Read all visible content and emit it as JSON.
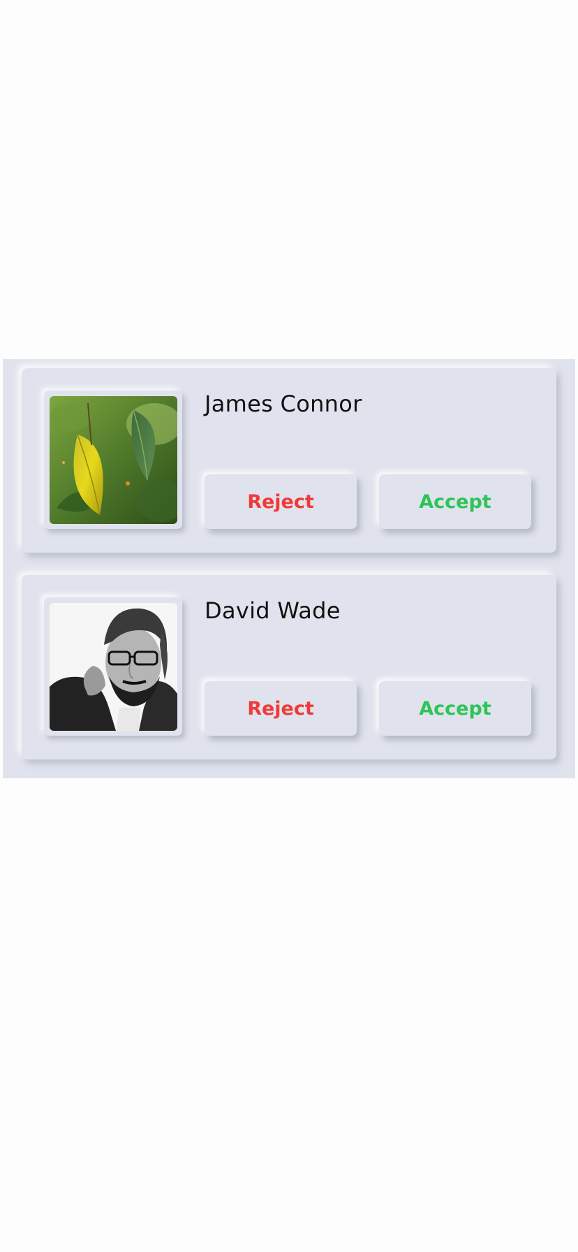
{
  "requests": [
    {
      "name": "James Connor",
      "avatar": "leaf-photo",
      "reject_label": "Reject",
      "accept_label": "Accept"
    },
    {
      "name": "David Wade",
      "avatar": "person-photo",
      "reject_label": "Reject",
      "accept_label": "Accept"
    }
  ],
  "colors": {
    "panel_bg": "#e0e3ed",
    "page_bg": "#fdfdfd",
    "reject": "#f03a3a",
    "accept": "#2ec458",
    "name_text": "#111111"
  }
}
